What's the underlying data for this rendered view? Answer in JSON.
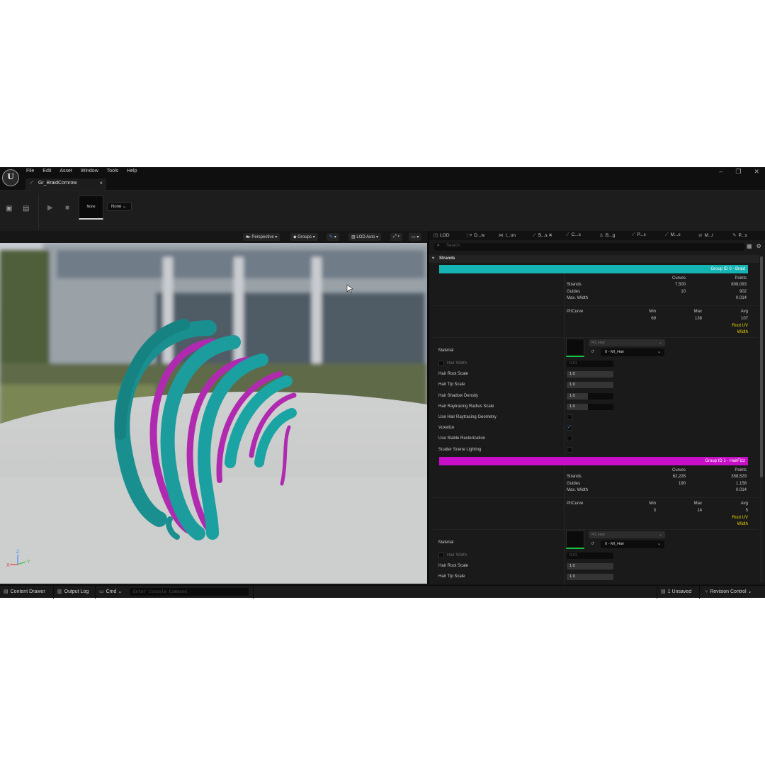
{
  "window": {
    "menus": [
      "File",
      "Edit",
      "Asset",
      "Window",
      "Tools",
      "Help"
    ],
    "tab_title": "Gr_BraidCornrow",
    "controls": [
      "–",
      "❐",
      "✕"
    ]
  },
  "toolbar": {
    "thumbnail_label": "None",
    "dropdown_label": "None"
  },
  "viewport": {
    "perspective_label": "Perspective",
    "groups_label": "Groups",
    "lod_label": "LOD Auto",
    "axes": {
      "z": "Z",
      "x": "X",
      "y": "Y"
    },
    "colors": {
      "braid": "#1a9a9a",
      "fizz": "#b02ab0",
      "ground": "#d7d7d7"
    }
  },
  "panel": {
    "tabs": [
      {
        "icon": "lod-icon",
        "label": "LOD"
      },
      {
        "icon": "drawing-icon",
        "label": "D...w"
      },
      {
        "icon": "interpolation-icon",
        "label": "I...on"
      },
      {
        "icon": "strands-icon",
        "label": "S...s"
      },
      {
        "icon": "cards-icon",
        "label": "C...s"
      },
      {
        "icon": "binding-icon",
        "label": "B...g"
      },
      {
        "icon": "physics-icon",
        "label": "P...s"
      },
      {
        "icon": "meshes-icon",
        "label": "M...s"
      },
      {
        "icon": "material-icon",
        "label": "M...l"
      },
      {
        "icon": "pencil-icon",
        "label": "P...s"
      }
    ],
    "search_placeholder": "Search",
    "section_title": "Strands",
    "groups": [
      {
        "title": "Group ID 0 - Braid",
        "color": "#15b4b4",
        "curves_header": "Curves",
        "points_header": "Points",
        "stats": [
          {
            "label": "Strands",
            "curves": "7,500",
            "points": "808,093"
          },
          {
            "label": "Guides",
            "curves": "10",
            "points": "902"
          },
          {
            "label": "Max. Width",
            "curves": "",
            "points": "0.014"
          }
        ],
        "ptcurve_label": "Pt/Curve",
        "min_header": "Min",
        "max_header": "Max",
        "avg_header": "Avg",
        "ptcurve": {
          "min": "69",
          "max": "138",
          "avg": "107"
        },
        "attributes": [
          "Root UV",
          "Width"
        ],
        "material_label": "Material",
        "material_combo": "MI_Hair",
        "material_pick": "0 - MI_Hair",
        "props": [
          {
            "label": "Hair Width",
            "value": "0.01",
            "type": "number",
            "enabled": false,
            "fill": 0
          },
          {
            "label": "Hair Root Scale",
            "value": "1.0",
            "type": "number",
            "enabled": true,
            "fill": 1.0
          },
          {
            "label": "Hair Tip Scale",
            "value": "1.0",
            "type": "number",
            "enabled": true,
            "fill": 1.0
          },
          {
            "label": "Hair Shadow Density",
            "value": "1.0",
            "type": "number",
            "enabled": true,
            "fill": 0.45
          },
          {
            "label": "Hair Raytracing Radius Scale",
            "value": "1.0",
            "type": "number",
            "enabled": true,
            "fill": 0.45
          },
          {
            "label": "Use Hair Raytracing Geometry",
            "type": "checkbox",
            "checked": false
          },
          {
            "label": "Voxelize",
            "type": "checkbox",
            "checked": true
          },
          {
            "label": "Use Stable Rasterization",
            "type": "checkbox",
            "checked": false
          },
          {
            "label": "Scatter Scene Lighting",
            "type": "checkbox",
            "checked": false
          }
        ]
      },
      {
        "title": "Group ID 1 - HairFizz",
        "color": "#c80fc8",
        "curves_header": "Curves",
        "points_header": "Points",
        "stats": [
          {
            "label": "Strands",
            "curves": "62,228",
            "points": "358,529"
          },
          {
            "label": "Guides",
            "curves": "190",
            "points": "1,158"
          },
          {
            "label": "Max. Width",
            "curves": "",
            "points": "0.014"
          }
        ],
        "ptcurve_label": "Pt/Curve",
        "min_header": "Min",
        "max_header": "Max",
        "avg_header": "Avg",
        "ptcurve": {
          "min": "3",
          "max": "14",
          "avg": "5"
        },
        "attributes": [
          "Root UV",
          "Width"
        ],
        "material_label": "Material",
        "material_combo": "MI_Hair",
        "material_pick": "0 - MI_Hair",
        "props": [
          {
            "label": "Hair Width",
            "value": "0.01",
            "type": "number",
            "enabled": false,
            "fill": 0
          },
          {
            "label": "Hair Root Scale",
            "value": "1.0",
            "type": "number",
            "enabled": true,
            "fill": 1.0
          },
          {
            "label": "Hair Tip Scale",
            "value": "1.0",
            "type": "number",
            "enabled": true,
            "fill": 1.0
          }
        ]
      }
    ]
  },
  "statusbar": {
    "content_drawer": "Content Drawer",
    "output_log": "Output Log",
    "cmd": "Cmd",
    "console_placeholder": "Enter Console Command",
    "unsaved": "1 Unsaved",
    "revision_control": "Revision Control"
  }
}
